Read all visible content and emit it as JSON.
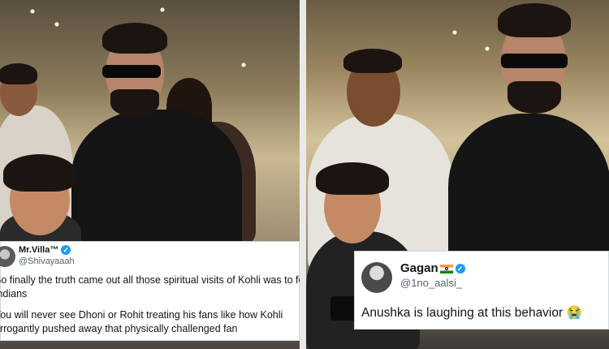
{
  "tweet1": {
    "name": "Mr.Villa™",
    "handle": "@Shivayaaah",
    "lines": [
      "So finally the truth came out all those spiritual visits of Kohli was to fool",
      "Indians",
      "You will never see Dhoni or Rohit treating his fans like how Kohli",
      "arrogantly pushed away that physically challenged fan"
    ]
  },
  "tweet2": {
    "name": "Gagan",
    "handle": "@1no_aalsi_",
    "text": "Anushka is laughing at this behavior 😭"
  },
  "icons": {
    "verified": "verified-badge-icon",
    "flag": "india-flag-icon",
    "emoji": "loudly-crying-face-emoji"
  },
  "colors": {
    "verified": "#1d9bf0",
    "handle": "#536471"
  }
}
